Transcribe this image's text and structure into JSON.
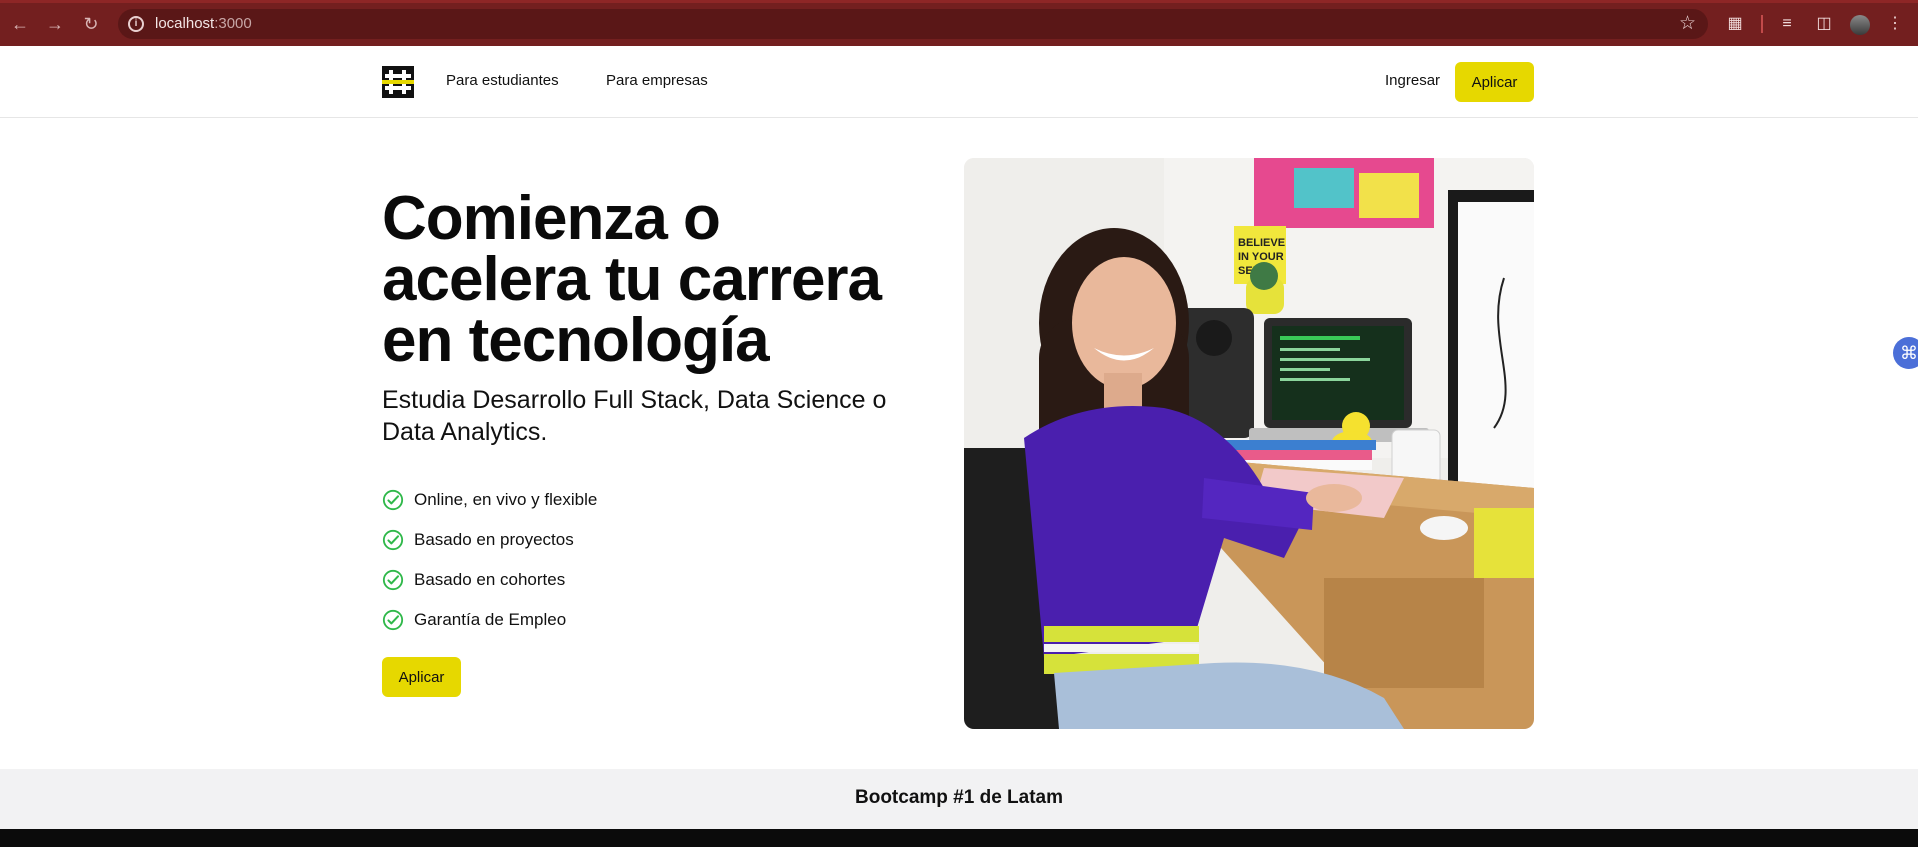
{
  "browser": {
    "url_host": "localhost",
    "url_port": ":3000"
  },
  "header": {
    "nav": [
      "Para estudiantes",
      "Para empresas"
    ],
    "login_label": "Ingresar",
    "apply_label": "Aplicar"
  },
  "hero": {
    "title_lines": [
      "Comienza o",
      "acelera tu carrera",
      "en tecnología"
    ],
    "subtitle": "Estudia Desarrollo Full Stack, Data Science o Data Analytics.",
    "features": [
      "Online, en vivo y flexible",
      "Basado en proyectos",
      "Basado en cohortes",
      "Garantía de Empleo"
    ],
    "apply_label": "Aplicar",
    "photo_poster_text": "BELIEVE IN YOUR SELF"
  },
  "banner": {
    "text": "Bootcamp #1 de Latam"
  },
  "colors": {
    "brand_yellow": "#e6d800",
    "check_green": "#2fb84a",
    "chrome_red": "#731f1f"
  }
}
